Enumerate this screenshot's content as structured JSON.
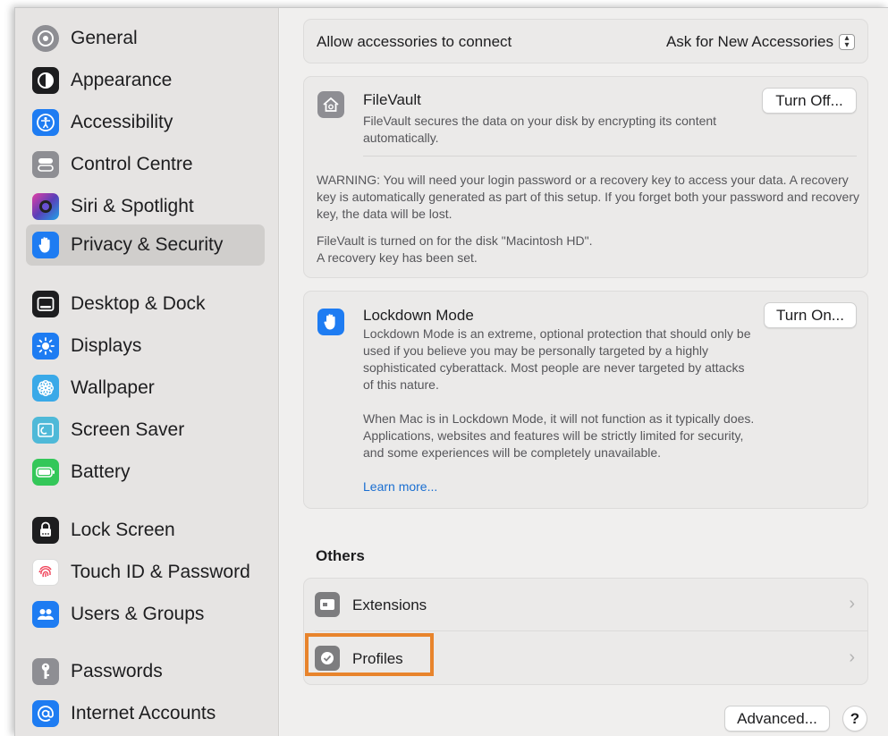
{
  "sidebar": {
    "items": [
      {
        "label": "General",
        "icon": "gear-icon",
        "color": "#8e8e93"
      },
      {
        "label": "Appearance",
        "icon": "appearance-icon",
        "color": "#1d1d1f"
      },
      {
        "label": "Accessibility",
        "icon": "accessibility-icon",
        "color": "#1e7cf2"
      },
      {
        "label": "Control Centre",
        "icon": "control-centre-icon",
        "color": "#8e8e93"
      },
      {
        "label": "Siri & Spotlight",
        "icon": "siri-icon",
        "color": "#5a3fb8"
      },
      {
        "label": "Privacy & Security",
        "icon": "hand-icon",
        "color": "#1e7cf2"
      },
      {
        "label": "Desktop & Dock",
        "icon": "dock-icon",
        "color": "#1d1d1f"
      },
      {
        "label": "Displays",
        "icon": "sun-icon",
        "color": "#1e7cf2"
      },
      {
        "label": "Wallpaper",
        "icon": "flower-icon",
        "color": "#3aa9e8"
      },
      {
        "label": "Screen Saver",
        "icon": "screen-saver-icon",
        "color": "#4fb9d8"
      },
      {
        "label": "Battery",
        "icon": "battery-icon",
        "color": "#34c759"
      },
      {
        "label": "Lock Screen",
        "icon": "lock-icon",
        "color": "#1d1d1f"
      },
      {
        "label": "Touch ID & Password",
        "icon": "fingerprint-icon",
        "color": "#ffffff"
      },
      {
        "label": "Users & Groups",
        "icon": "users-icon",
        "color": "#1e7cf2"
      },
      {
        "label": "Passwords",
        "icon": "key-icon",
        "color": "#8e8e93"
      },
      {
        "label": "Internet Accounts",
        "icon": "at-icon",
        "color": "#1e7cf2"
      }
    ]
  },
  "accessories": {
    "label": "Allow accessories to connect",
    "value": "Ask for New Accessories",
    "stepper_glyph": "⌃⌄"
  },
  "filevault": {
    "title": "FileVault",
    "description": "FileVault secures the data on your disk by encrypting its content automatically.",
    "button": "Turn Off...",
    "warning": "WARNING: You will need your login password or a recovery key to access your data. A recovery key is automatically generated as part of this setup. If you forget both your password and recovery key, the data will be lost.",
    "status_line1": "FileVault is turned on for the disk \"Macintosh HD\".",
    "status_line2": "A recovery key has been set."
  },
  "lockdown": {
    "title": "Lockdown Mode",
    "description": "Lockdown Mode is an extreme, optional protection that should only be used if you believe you may be personally targeted by a highly sophisticated cyberattack. Most people are never targeted by attacks of this nature.",
    "description2": "When Mac is in Lockdown Mode, it will not function as it typically does. Applications, websites and features will be strictly limited for security, and some experiences will be completely unavailable.",
    "link": "Learn more...",
    "button": "Turn On..."
  },
  "others": {
    "heading": "Others",
    "items": [
      {
        "label": "Extensions",
        "icon": "extensions-icon"
      },
      {
        "label": "Profiles",
        "icon": "profiles-icon"
      }
    ]
  },
  "footer": {
    "advanced": "Advanced...",
    "help": "?"
  },
  "colors": {
    "highlight": "#e8842c",
    "link": "#1a6fd1",
    "accent": "#1e7cf2"
  }
}
